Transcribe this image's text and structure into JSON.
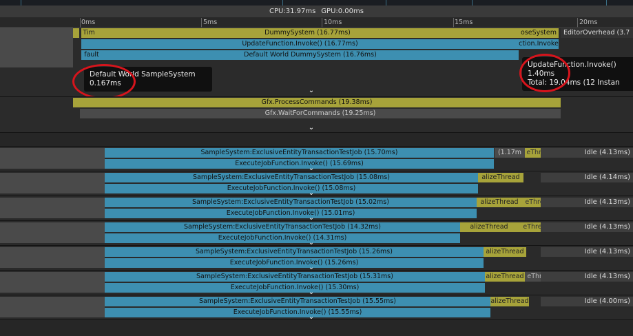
{
  "header": {
    "cpu": "CPU:31.97ms",
    "gpu": "GPU:0.00ms"
  },
  "ruler": {
    "labels": [
      "0ms",
      "5ms",
      "10ms",
      "15ms",
      "20ms"
    ]
  },
  "main_thread": {
    "bar1": "DummySystem (16.77ms)",
    "bar1_right": "oseSystem",
    "bar1_editor": "EditorOverhead (3.7",
    "bar1_small": "Tim",
    "bar2": "UpdateFunction.Invoke() (16.77ms)",
    "bar2_right": "ction.Invoke",
    "bar3": "Default World DummySystem (16.76ms)",
    "bar3_small": "fault"
  },
  "tooltip_left": {
    "line1": "Default World SampleSystem",
    "line2": "0.167ms"
  },
  "tooltip_right": {
    "line1": "UpdateFunction.Invoke()",
    "line2": "1.40ms",
    "line3": "Total: 19.04ms (12 Instan"
  },
  "render_thread": {
    "bar1": "Gfx.ProcessCommands (19.38ms)",
    "bar2": "Gfx.WaitForCommands (19.25ms)"
  },
  "chevron": "⌄",
  "worker_rows": [
    {
      "job": "SampleSystem:ExclusiveEntityTransactionTestJob (15.70ms)",
      "exec": "ExecuteJobFunction.Invoke() (15.69ms)",
      "after1": "(1.17m",
      "after2": "eThre",
      "idle": "Idle (4.13ms)"
    },
    {
      "job": "SampleSystem:ExclusiveEntityTransactionTestJob (15.08ms)",
      "exec": "ExecuteJobFunction.Invoke() (15.08ms)",
      "after1": "alizeThread",
      "after2": "",
      "idle": "Idle (4.14ms)"
    },
    {
      "job": "SampleSystem:ExclusiveEntityTransactionTestJob (15.02ms)",
      "exec": "ExecuteJobFunction.Invoke() (15.01ms)",
      "after1": "alizeThread",
      "after2": "eThre",
      "idle": "Idle (4.13ms)"
    },
    {
      "job": "SampleSystem:ExclusiveEntityTransactionTestJob (14.32ms)",
      "exec": "ExecuteJobFunction.Invoke() (14.31ms)",
      "after1": "alizeThread",
      "after2": "eThre",
      "idle": "Idle (4.13ms)"
    },
    {
      "job": "SampleSystem:ExclusiveEntityTransactionTestJob (15.26ms)",
      "exec": "ExecuteJobFunction.Invoke() (15.26ms)",
      "after1": "alizeThread",
      "after2": "",
      "idle": "Idle (4.13ms)"
    },
    {
      "job": "SampleSystem:ExclusiveEntityTransactionTestJob (15.31ms)",
      "exec": "ExecuteJobFunction.Invoke() (15.30ms)",
      "after1": "alizeThread",
      "after2": "eThre",
      "idle": "Idle (4.13ms)"
    },
    {
      "job": "SampleSystem:ExclusiveEntityTransactionTestJob (15.55ms)",
      "exec": "ExecuteJobFunction.Invoke() (15.55ms)",
      "after1": "alizeThread",
      "after2": "",
      "idle": "Idle (4.00ms)"
    }
  ]
}
